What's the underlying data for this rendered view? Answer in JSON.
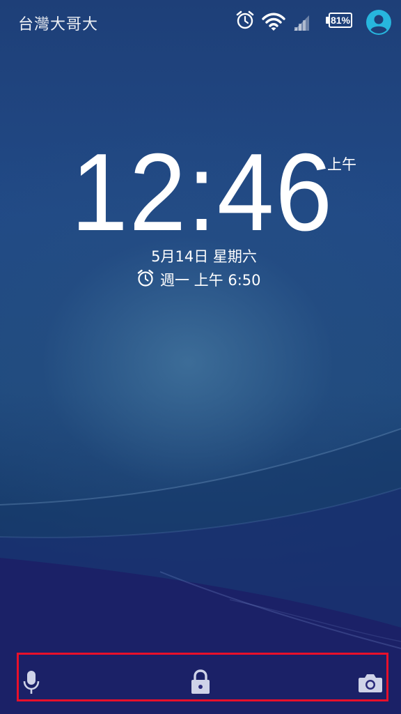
{
  "status_bar": {
    "carrier": "台灣大哥大",
    "battery_percent": "81%",
    "icons": [
      "alarm-icon",
      "wifi-icon",
      "cellular-signal-icon",
      "battery-icon",
      "user-avatar-icon"
    ]
  },
  "clock": {
    "time": "12:46",
    "am_pm": "上午",
    "date": "5月14日 星期六",
    "next_alarm": "週一 上午 6:50"
  },
  "bottom_actions": {
    "icons": [
      "microphone-icon",
      "lock-icon",
      "camera-icon"
    ]
  },
  "colors": {
    "avatar_accent": "#27b6de",
    "highlight_border": "#e8102a",
    "background_top": "#1e3f78",
    "background_bottom": "#1d1e66"
  }
}
